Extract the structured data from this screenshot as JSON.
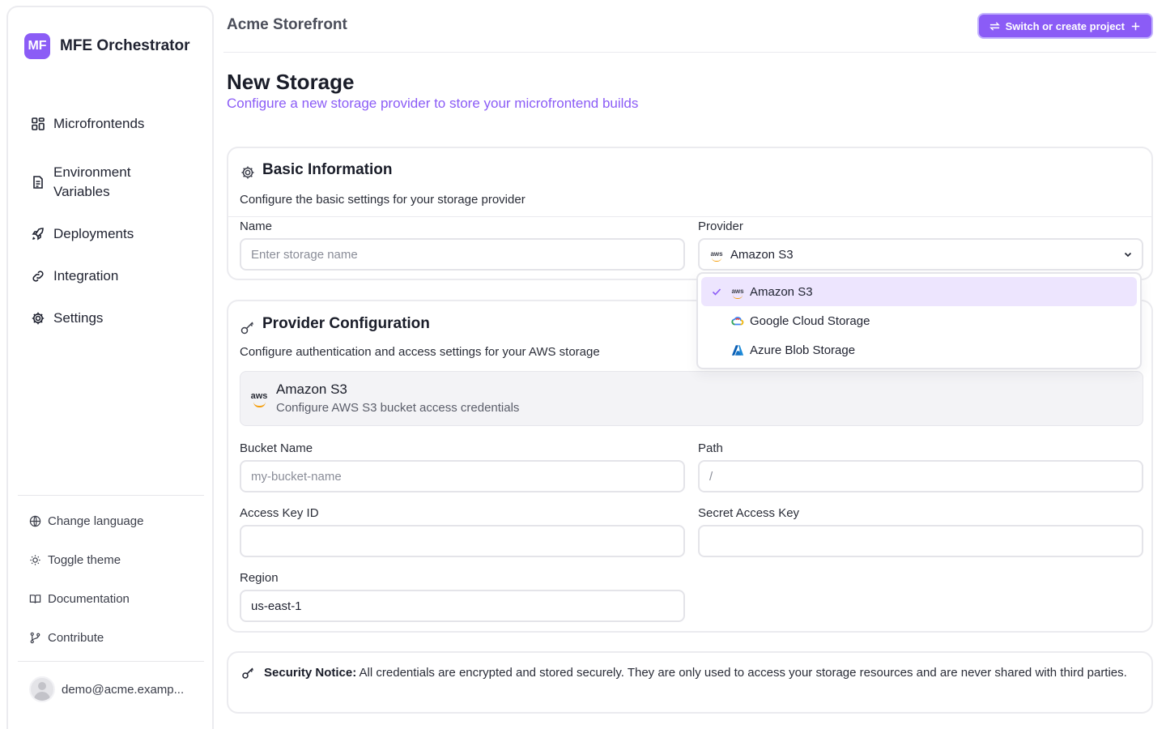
{
  "sidebar": {
    "brand_initials": "MF",
    "brand_name": "MFE Orchestrator",
    "nav": [
      {
        "label": "Microfrontends",
        "icon": "grid-icon"
      },
      {
        "label": "Environment Variables",
        "icon": "file-text-icon"
      },
      {
        "label": "Deployments",
        "icon": "rocket-icon"
      },
      {
        "label": "Integration",
        "icon": "link-icon"
      },
      {
        "label": "Settings",
        "icon": "gear-icon"
      }
    ],
    "footer": [
      {
        "label": "Change language",
        "icon": "globe-icon"
      },
      {
        "label": "Toggle theme",
        "icon": "sun-icon"
      },
      {
        "label": "Documentation",
        "icon": "book-icon"
      },
      {
        "label": "Contribute",
        "icon": "git-branch-icon"
      }
    ],
    "user_email": "demo@acme.examp..."
  },
  "header": {
    "project_name": "Acme Storefront",
    "switch_label": "Switch or create project"
  },
  "page": {
    "title": "New Storage",
    "subtitle": "Configure a new storage provider to store your microfrontend builds"
  },
  "basic": {
    "title": "Basic Information",
    "description": "Configure the basic settings for your storage provider",
    "name_label": "Name",
    "name_placeholder": "Enter storage name",
    "name_value": "",
    "provider_label": "Provider",
    "provider_value": "Amazon S3",
    "provider_options": [
      {
        "label": "Amazon S3",
        "selected": true
      },
      {
        "label": "Google Cloud Storage",
        "selected": false
      },
      {
        "label": "Azure Blob Storage",
        "selected": false
      }
    ]
  },
  "config": {
    "title": "Provider Configuration",
    "description": "Configure authentication and access settings for your AWS storage",
    "provider_box_logo": "aws",
    "provider_box_title": "Amazon S3",
    "provider_box_desc": "Configure AWS S3 bucket access credentials",
    "bucket_label": "Bucket Name",
    "bucket_placeholder": "my-bucket-name",
    "path_label": "Path",
    "path_placeholder": "/",
    "access_key_label": "Access Key ID",
    "access_key_value": "",
    "secret_label": "Secret Access Key",
    "secret_value": "",
    "region_label": "Region",
    "region_value": "us-east-1"
  },
  "notice": {
    "title": "Security Notice:",
    "text": "All credentials are encrypted and stored securely. They are only used to access your storage resources and are never shared with third parties."
  },
  "colors": {
    "accent": "#8b5cf6",
    "accent_soft": "#ede5fe",
    "border": "#ebebef"
  }
}
